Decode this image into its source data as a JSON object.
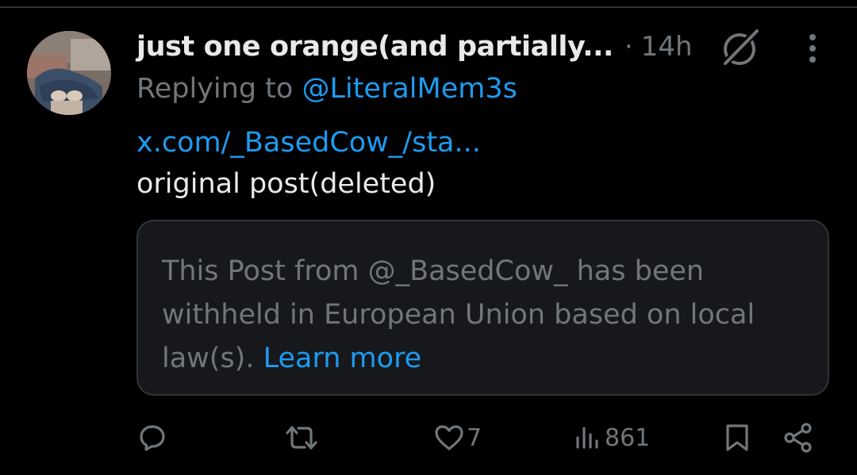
{
  "post": {
    "display_name": "just one orange(and partially...",
    "dot": "·",
    "timestamp": "14h",
    "reply_label": "Replying to",
    "reply_handle": "@LiteralMem3s",
    "link_text": "x.com/_BasedCow_/sta...",
    "text": "original post(deleted)"
  },
  "withheld": {
    "message": "This Post from @_BasedCow_ has been withheld in European Union based on local law(s).",
    "learn_more": "Learn more"
  },
  "actions": {
    "likes": "7",
    "views": "861"
  },
  "icons": {
    "avatar": "avatar",
    "grok": "grok-icon",
    "more": "more-icon",
    "reply": "reply-icon",
    "repost": "repost-icon",
    "like": "heart-icon",
    "views": "views-icon",
    "bookmark": "bookmark-icon",
    "share": "share-icon"
  },
  "colors": {
    "background": "#000000",
    "text_primary": "#e7e9ea",
    "text_secondary": "#71767b",
    "accent": "#1d9bf0",
    "card_background": "#16181c",
    "border": "#2f3336"
  }
}
